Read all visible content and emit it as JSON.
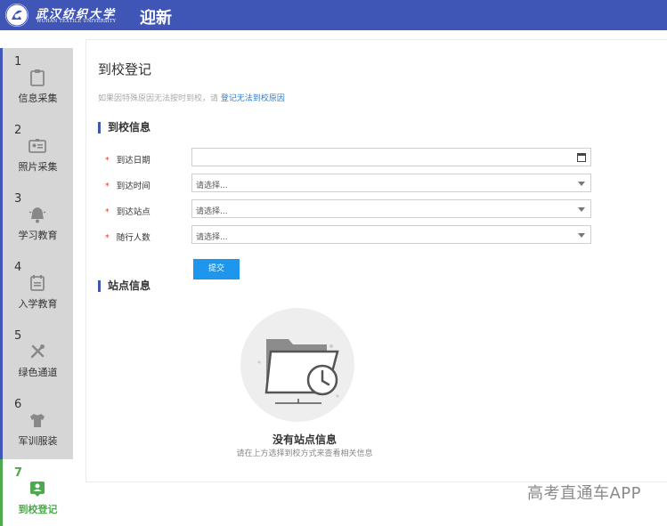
{
  "header": {
    "logo_cn": "武汉纺织大学",
    "logo_en": "WUHAN TEXTILE UNIVERSITY",
    "title": "迎新"
  },
  "sidebar": {
    "steps": [
      {
        "num": "1",
        "label": "信息采集",
        "icon": "clipboard-icon"
      },
      {
        "num": "2",
        "label": "照片采集",
        "icon": "id-card-icon"
      },
      {
        "num": "3",
        "label": "学习教育",
        "icon": "bell-icon"
      },
      {
        "num": "4",
        "label": "入学教育",
        "icon": "calendar-icon"
      },
      {
        "num": "5",
        "label": "绿色通道",
        "icon": "tools-icon"
      },
      {
        "num": "6",
        "label": "军训服装",
        "icon": "tshirt-icon"
      },
      {
        "num": "7",
        "label": "到校登记",
        "icon": "person-badge-icon",
        "active": true
      }
    ]
  },
  "main": {
    "page_title": "到校登记",
    "notice_text": "如果因特殊原因无法按时到校，请",
    "notice_link": "登记无法到校原因",
    "section_arrival": "到校信息",
    "fields": [
      {
        "label": "到达日期",
        "value": "",
        "type": "date"
      },
      {
        "label": "到达时间",
        "value": "请选择...",
        "type": "select"
      },
      {
        "label": "到达站点",
        "value": "请选择...",
        "type": "select"
      },
      {
        "label": "随行人数",
        "value": "请选择...",
        "type": "select"
      }
    ],
    "submit_label": "提交",
    "section_station": "站点信息",
    "empty_title": "没有站点信息",
    "empty_subtitle": "请在上方选择到校方式来查看相关信息"
  },
  "watermark": "高考直通车APP",
  "colors": {
    "header_bg": "#3f56b7",
    "sidebar_step_bg": "#d6d6d6",
    "active_green": "#4ca94d",
    "submit_blue": "#1e96ec",
    "required_red": "#e53935",
    "link_blue": "#2e7fd1"
  }
}
